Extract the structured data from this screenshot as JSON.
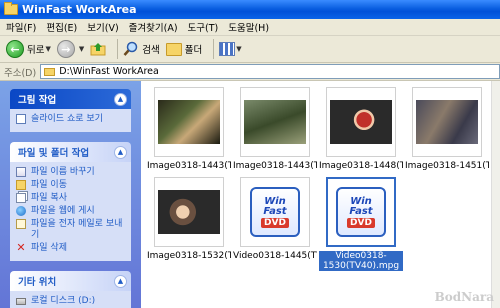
{
  "window": {
    "title": "WinFast WorkArea"
  },
  "menu": [
    "파일(F)",
    "편집(E)",
    "보기(V)",
    "즐겨찾기(A)",
    "도구(T)",
    "도움말(H)"
  ],
  "toolbar": {
    "back_label": "뒤로",
    "search_label": "검색",
    "folders_label": "폴더"
  },
  "address": {
    "label": "주소(D)",
    "path": "D:\\WinFast WorkArea"
  },
  "sidebar": {
    "picture_tasks": {
      "title": "그림 작업",
      "items": [
        "슬라이드 쇼로 보기"
      ]
    },
    "file_tasks": {
      "title": "파일 및 폴더 작업",
      "items": [
        "파일 이름 바꾸기",
        "파일 이동",
        "파일 복사",
        "파일을 웹에 게시",
        "파일을 전자 메일로 보내기",
        "파일 삭제"
      ]
    },
    "other_places": {
      "title": "기타 위치",
      "items": [
        "로컬 디스크 (D:)"
      ]
    }
  },
  "files": [
    {
      "name": "Image0318-1443(T...",
      "kind": "image",
      "tone": "#3b4a2c"
    },
    {
      "name": "Image0318-1443(T...",
      "kind": "image",
      "tone": "#5b6a4a"
    },
    {
      "name": "Image0318-1448(T...",
      "kind": "image",
      "tone": "#6c3a3a"
    },
    {
      "name": "Image0318-1451(T...",
      "kind": "image",
      "tone": "#5a5a6a"
    },
    {
      "name": "Image0318-1532(T...",
      "kind": "image",
      "tone": "#6a5a4a"
    },
    {
      "name": "Video0318-1445(TV...",
      "kind": "video"
    },
    {
      "name": "Video0318-1530(TV40).mpg",
      "kind": "video"
    }
  ],
  "watermark": "BodNara"
}
